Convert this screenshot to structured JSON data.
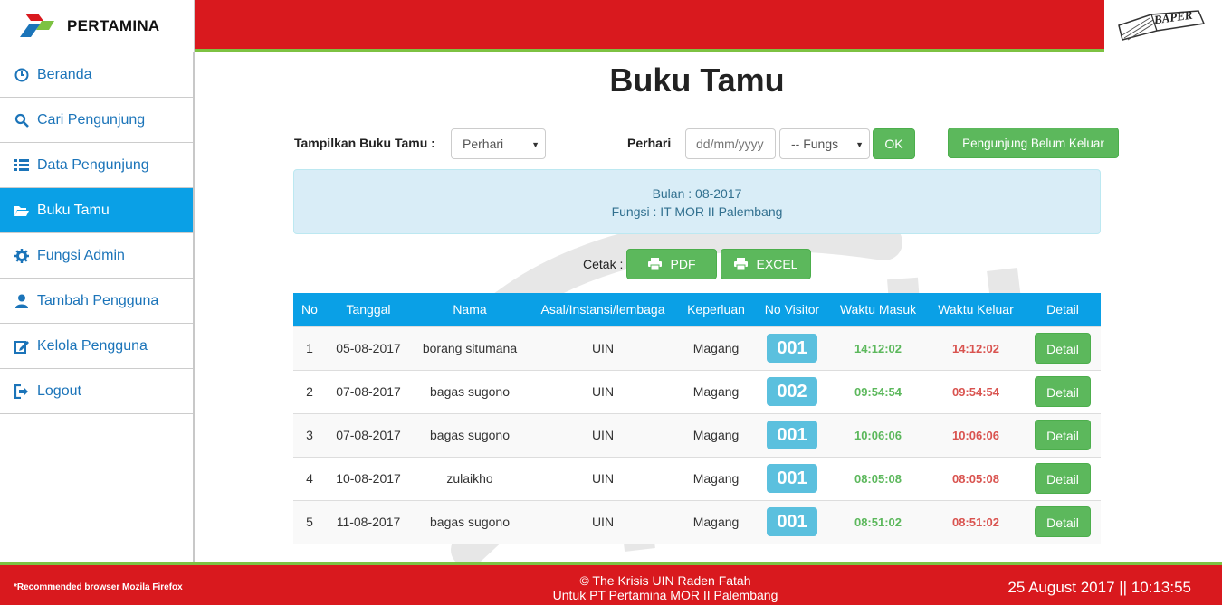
{
  "brand": {
    "name": "PERTAMINA",
    "baper_text": "BAPER"
  },
  "sidebar": {
    "items": [
      {
        "label": "Beranda",
        "icon": "clock-icon"
      },
      {
        "label": "Cari Pengunjung",
        "icon": "search-icon"
      },
      {
        "label": "Data Pengunjung",
        "icon": "list-icon"
      },
      {
        "label": "Buku Tamu",
        "icon": "folder-open-icon",
        "active": true
      },
      {
        "label": "Fungsi Admin",
        "icon": "gear-icon"
      },
      {
        "label": "Tambah Pengguna",
        "icon": "user-icon"
      },
      {
        "label": "Kelola Pengguna",
        "icon": "edit-icon"
      },
      {
        "label": "Logout",
        "icon": "logout-icon"
      }
    ]
  },
  "main": {
    "title": "Buku Tamu",
    "filter": {
      "label": "Tampilkan Buku Tamu :",
      "mode_value": "Perhari",
      "perhari_label": "Perhari",
      "date_placeholder": "dd/mm/yyyy",
      "fungsi_value": "-- Fungs",
      "ok_label": "OK",
      "belum_keluar_label": "Pengunjung Belum Keluar"
    },
    "info": {
      "bulan": "Bulan : 08-2017",
      "fungsi": "Fungsi : IT MOR II Palembang"
    },
    "cetak": {
      "label": "Cetak :",
      "pdf_label": "PDF",
      "excel_label": "EXCEL"
    },
    "table": {
      "headers": [
        "No",
        "Tanggal",
        "Nama",
        "Asal/Instansi/lembaga",
        "Keperluan",
        "No Visitor",
        "Waktu Masuk",
        "Waktu Keluar",
        "Detail"
      ],
      "rows": [
        {
          "no": "1",
          "tanggal": "05-08-2017",
          "nama": "borang situmana",
          "asal": "UIN",
          "keperluan": "Magang",
          "visitor": "001",
          "masuk": "14:12:02",
          "keluar": "14:12:02",
          "detail": "Detail"
        },
        {
          "no": "2",
          "tanggal": "07-08-2017",
          "nama": "bagas sugono",
          "asal": "UIN",
          "keperluan": "Magang",
          "visitor": "002",
          "masuk": "09:54:54",
          "keluar": "09:54:54",
          "detail": "Detail"
        },
        {
          "no": "3",
          "tanggal": "07-08-2017",
          "nama": "bagas sugono",
          "asal": "UIN",
          "keperluan": "Magang",
          "visitor": "001",
          "masuk": "10:06:06",
          "keluar": "10:06:06",
          "detail": "Detail"
        },
        {
          "no": "4",
          "tanggal": "10-08-2017",
          "nama": "zulaikho",
          "asal": "UIN",
          "keperluan": "Magang",
          "visitor": "001",
          "masuk": "08:05:08",
          "keluar": "08:05:08",
          "detail": "Detail"
        },
        {
          "no": "5",
          "tanggal": "11-08-2017",
          "nama": "bagas sugono",
          "asal": "UIN",
          "keperluan": "Magang",
          "visitor": "001",
          "masuk": "08:51:02",
          "keluar": "08:51:02",
          "detail": "Detail"
        }
      ]
    }
  },
  "footer": {
    "recommend": "*Recommended browser Mozila Firefox",
    "line1": "© The Krisis UIN Raden Fatah",
    "line2": "Untuk PT Pertamina MOR II Palembang",
    "clock": "25 August 2017 || 10:13:55"
  },
  "colors": {
    "red": "#d9191e",
    "green_strip": "#7dc242",
    "blue": "#0aa0e6",
    "btn_green": "#5cb85c",
    "badge_blue": "#5bc0de"
  }
}
